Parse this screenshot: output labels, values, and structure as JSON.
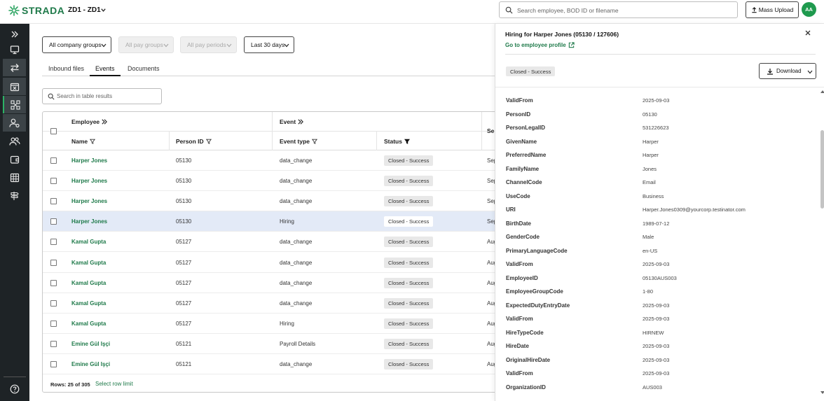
{
  "app": {
    "brand": "STRADA",
    "org": "ZD1 - ZD1",
    "search_placeholder": "Search employee, BOD ID or filename",
    "mass_upload_label": "Mass Upload",
    "avatar_initials": "AA"
  },
  "colors": {
    "brand_green": "#1f7a4a",
    "sidebar_bg": "#1e2326",
    "avatar_green": "#1f9a4e",
    "highlight_row": "#e3eaf7"
  },
  "sidebar": {
    "items": [
      {
        "icon": "expand-chevrons-icon"
      },
      {
        "icon": "monitor-icon"
      },
      {
        "icon": "transfer-arrows-icon"
      },
      {
        "icon": "calendar-x-icon"
      },
      {
        "icon": "flow-network-icon"
      },
      {
        "icon": "user-settings-icon"
      },
      {
        "icon": "users-icon"
      },
      {
        "icon": "wallet-icon"
      },
      {
        "icon": "grid-table-icon"
      },
      {
        "icon": "signpost-icon"
      },
      {
        "icon": "help-icon"
      }
    ]
  },
  "filters": {
    "company_groups": "All company groups",
    "pay_groups": "All pay groups",
    "pay_periods": "All pay periods",
    "date_range": "Last 30 days"
  },
  "tabs": [
    {
      "label": "Inbound files"
    },
    {
      "label": "Events"
    },
    {
      "label": "Documents"
    }
  ],
  "table": {
    "search_placeholder": "Search in table results",
    "group_headers": {
      "employee": "Employee",
      "event": "Event",
      "truncated": "Se"
    },
    "columns": {
      "name": "Name",
      "person_id": "Person ID",
      "event_type": "Event type",
      "status": "Status"
    },
    "rows": [
      {
        "name": "Harper Jones",
        "person_id": "05130",
        "event_type": "data_change",
        "status": "Closed - Success",
        "date": "Sep"
      },
      {
        "name": "Harper Jones",
        "person_id": "05130",
        "event_type": "data_change",
        "status": "Closed - Success",
        "date": "Sep"
      },
      {
        "name": "Harper Jones",
        "person_id": "05130",
        "event_type": "data_change",
        "status": "Closed - Success",
        "date": "Sep"
      },
      {
        "name": "Harper Jones",
        "person_id": "05130",
        "event_type": "Hiring",
        "status": "Closed - Success",
        "date": "Sep"
      },
      {
        "name": "Kamal Gupta",
        "person_id": "05127",
        "event_type": "data_change",
        "status": "Closed - Success",
        "date": "Aug"
      },
      {
        "name": "Kamal Gupta",
        "person_id": "05127",
        "event_type": "data_change",
        "status": "Closed - Success",
        "date": "Aug"
      },
      {
        "name": "Kamal Gupta",
        "person_id": "05127",
        "event_type": "data_change",
        "status": "Closed - Success",
        "date": "Aug"
      },
      {
        "name": "Kamal Gupta",
        "person_id": "05127",
        "event_type": "data_change",
        "status": "Closed - Success",
        "date": "Aug"
      },
      {
        "name": "Kamal Gupta",
        "person_id": "05127",
        "event_type": "Hiring",
        "status": "Closed - Success",
        "date": "Aug"
      },
      {
        "name": "Emine Gül Işçi",
        "person_id": "05121",
        "event_type": "Payroll Details",
        "status": "Closed - Success",
        "date": "Aug"
      },
      {
        "name": "Emine Gül Işçi",
        "person_id": "05121",
        "event_type": "data_change",
        "status": "Closed - Success",
        "date": "Aug"
      }
    ],
    "rows_count": "Rows: 25 of 305",
    "row_limit_label": "Select row limit"
  },
  "detail": {
    "title": "Hiring for Harper Jones (05130 / 127606)",
    "profile_link": "Go to employee profile",
    "status": "Closed - Success",
    "download_label": "Download",
    "fields": [
      {
        "key": "ValidFrom",
        "value": "2025-09-03"
      },
      {
        "key": "PersonID",
        "value": "05130"
      },
      {
        "key": "PersonLegalID",
        "value": "531226623"
      },
      {
        "key": "GivenName",
        "value": "Harper"
      },
      {
        "key": "PreferredName",
        "value": "Harper"
      },
      {
        "key": "FamilyName",
        "value": "Jones"
      },
      {
        "key": "ChannelCode",
        "value": "Email"
      },
      {
        "key": "UseCode",
        "value": "Business"
      },
      {
        "key": "URI",
        "value": "Harper.Jones0309@yourcorp.testinator.com"
      },
      {
        "key": "BirthDate",
        "value": "1989-07-12"
      },
      {
        "key": "GenderCode",
        "value": "Male"
      },
      {
        "key": "PrimaryLanguageCode",
        "value": "en-US"
      },
      {
        "key": "ValidFrom",
        "value": "2025-09-03"
      },
      {
        "key": "EmployeeID",
        "value": "05130AUS003"
      },
      {
        "key": "EmployeeGroupCode",
        "value": "1-80"
      },
      {
        "key": "ExpectedDutyEntryDate",
        "value": "2025-09-03"
      },
      {
        "key": "ValidFrom",
        "value": "2025-09-03"
      },
      {
        "key": "HireTypeCode",
        "value": "HIRNEW"
      },
      {
        "key": "HireDate",
        "value": "2025-09-03"
      },
      {
        "key": "OriginalHireDate",
        "value": "2025-09-03"
      },
      {
        "key": "ValidFrom",
        "value": "2025-09-03"
      },
      {
        "key": "OrganizationID",
        "value": "AUS003"
      }
    ]
  }
}
